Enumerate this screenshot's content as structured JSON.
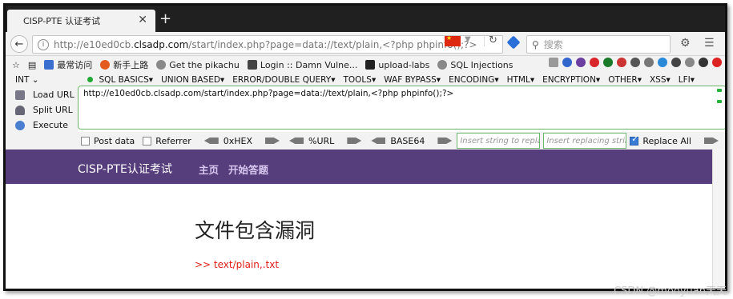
{
  "browser": {
    "tab_title": "CISP-PTE 认证考试",
    "tab_close": "✕",
    "new_tab": "+",
    "url_scheme_host_pre": "http://e10ed0cb.",
    "url_host": "clsadp.com",
    "url_rest": "/start/index.php?page=data://text/plain,<?php phpinfo();?>",
    "search_placeholder": "搜索",
    "bookmarks": [
      {
        "label": "最常访问",
        "color": "#3b6fcf"
      },
      {
        "label": "新手上路",
        "color": "#e35b1e"
      },
      {
        "label": "Get the pikachu",
        "color": "#888888"
      },
      {
        "label": "Login :: Damn Vulne...",
        "color": "#444444"
      },
      {
        "label": "upload-labs",
        "color": "#222222"
      },
      {
        "label": "SQL Injections",
        "color": "#888888"
      }
    ]
  },
  "hackbar": {
    "menu": [
      "INT",
      "SQL BASICS",
      "UNION BASED",
      "ERROR/DOUBLE QUERY",
      "TOOLS",
      "WAF BYPASS",
      "ENCODING",
      "HTML",
      "ENCRYPTION",
      "OTHER",
      "XSS",
      "LFI"
    ],
    "load_url": "Load URL",
    "split_url": "Split URL",
    "execute": "Execute",
    "url_value": "http://e10ed0cb.clsadp.com/start/index.php?page=data://text/plain,<?php phpinfo();?>",
    "post_data": "Post data",
    "referrer": "Referrer",
    "hex": "0xHEX",
    "url_enc": "%URL",
    "base64": "BASE64",
    "insert_placeholder": "Insert string to replace",
    "replacing_placeholder": "Insert replacing string",
    "replace_all": "Replace All"
  },
  "page": {
    "brand": "CISP-PTE认证考试",
    "nav_home": "主页",
    "nav_start": "开始答题",
    "heading": "文件包含漏洞",
    "output": ">> text/plain,.txt"
  },
  "watermark": "CSDN @mooyuan天天"
}
